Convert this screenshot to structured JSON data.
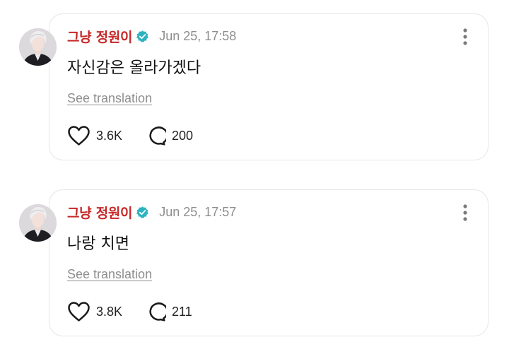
{
  "colors": {
    "author_name": "#c62828",
    "verified_badge": "#2bb3c0",
    "meta_text": "#8e8e8e",
    "card_border": "#e6e6e6"
  },
  "icons": {
    "verified": "verified-badge-icon",
    "more": "more-vertical-icon",
    "like": "heart-outline-icon",
    "reply": "speech-bubble-icon"
  },
  "posts": [
    {
      "author": "그냥 정원이",
      "timestamp": "Jun 25, 17:58",
      "text": "자신감은 올라가겠다",
      "translate_label": "See translation",
      "likes": "3.6K",
      "replies": "200"
    },
    {
      "author": "그냥 정원이",
      "timestamp": "Jun 25, 17:57",
      "text": "나랑 치면",
      "translate_label": "See translation",
      "likes": "3.8K",
      "replies": "211"
    }
  ]
}
